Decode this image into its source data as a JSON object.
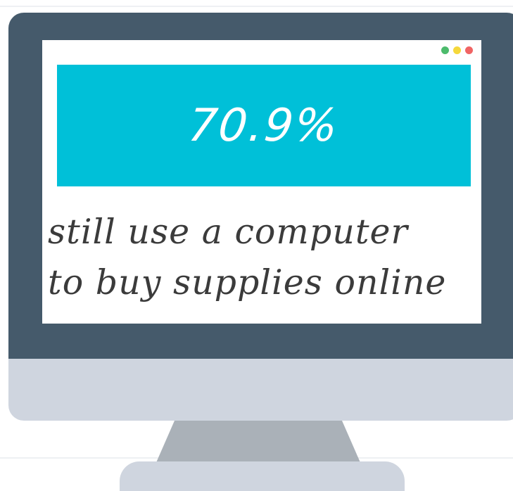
{
  "statistic": {
    "value": "70.9%",
    "caption_line_1": "still use a computer",
    "caption_line_2": "to buy supplies online"
  },
  "window_controls": [
    "green-dot",
    "yellow-dot",
    "red-dot"
  ],
  "colors": {
    "bezel": "#455a6b",
    "chin": "#cfd5df",
    "stand": "#aab1b8",
    "stat_box": "#00c0d8",
    "dot_green": "#4cbb6c",
    "dot_yellow": "#f5d83b",
    "dot_red": "#f06464"
  }
}
